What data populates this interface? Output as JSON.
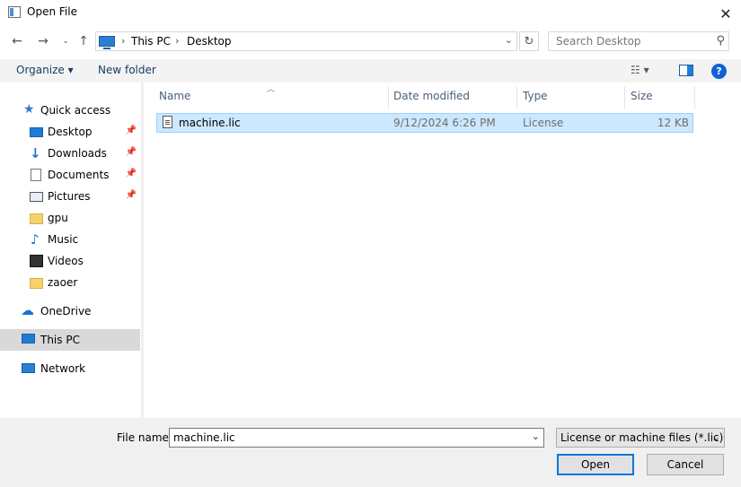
{
  "window": {
    "title": "Open File"
  },
  "address": {
    "crumbs": [
      "This PC",
      "Desktop"
    ]
  },
  "search": {
    "placeholder": "Search Desktop"
  },
  "toolbar": {
    "organize": "Organize ▾",
    "new_folder": "New folder"
  },
  "nav": {
    "items": [
      {
        "label": "Quick access",
        "icon": "star-icon"
      },
      {
        "label": "Desktop",
        "icon": "desktop-icon",
        "pinned": true
      },
      {
        "label": "Downloads",
        "icon": "download-icon",
        "pinned": true
      },
      {
        "label": "Documents",
        "icon": "document-icon",
        "pinned": true
      },
      {
        "label": "Pictures",
        "icon": "pictures-icon",
        "pinned": true
      },
      {
        "label": "gpu",
        "icon": "folder-icon"
      },
      {
        "label": "Music",
        "icon": "music-icon"
      },
      {
        "label": "Videos",
        "icon": "video-icon"
      },
      {
        "label": "zaoer",
        "icon": "folder-icon"
      },
      {
        "label": "OneDrive",
        "icon": "cloud-icon"
      },
      {
        "label": "This PC",
        "icon": "computer-icon",
        "selected": true
      },
      {
        "label": "Network",
        "icon": "network-icon"
      }
    ]
  },
  "columns": {
    "name": "Name",
    "date": "Date modified",
    "type": "Type",
    "size": "Size"
  },
  "files": [
    {
      "name": "machine.lic",
      "date": "9/12/2024 6:26 PM",
      "type": "License",
      "size": "12 KB"
    }
  ],
  "bottom": {
    "file_name_label": "File name:",
    "file_name_value": "machine.lic",
    "filter": "License or machine files (*.lic)",
    "open_label": "Open",
    "cancel_label": "Cancel"
  },
  "colors": {
    "selection": "#cce8ff",
    "accent": "#0078d7",
    "help": "#1062d6"
  }
}
